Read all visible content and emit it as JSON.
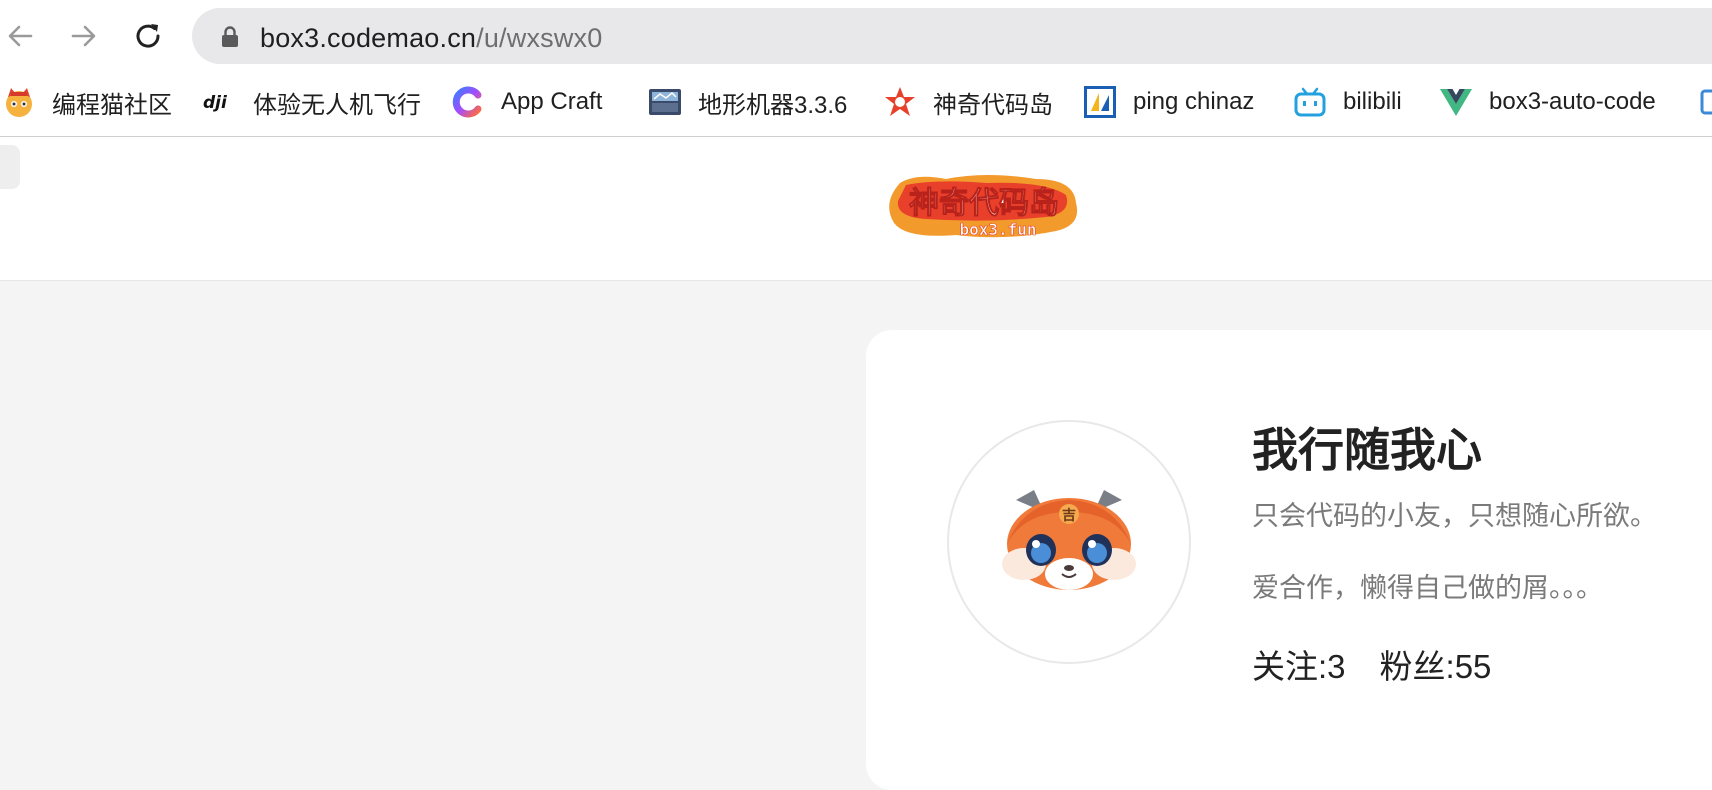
{
  "browser": {
    "url_host": "box3.codemao.cn",
    "url_path": "/u/wxswx0"
  },
  "bookmarks": [
    {
      "label": "编程猫社区",
      "icon": "codemao-community-icon"
    },
    {
      "label": "体验无人机飞行",
      "icon": "dji-icon"
    },
    {
      "label": "App Craft",
      "icon": "app-craft-icon"
    },
    {
      "label": "地形机器3.3.6",
      "icon": "terrain-machine-icon"
    },
    {
      "label": "神奇代码岛",
      "icon": "box3-star-icon"
    },
    {
      "label": "ping chinaz",
      "icon": "chinaz-icon"
    },
    {
      "label": "bilibili",
      "icon": "bilibili-icon"
    },
    {
      "label": "box3-auto-code",
      "icon": "vue-icon"
    }
  ],
  "site": {
    "logo_text": "神奇代码岛",
    "logo_subtext": "box3.fun"
  },
  "profile": {
    "name": "我行随我心",
    "bio_line1": "只会代码的小友，只想随心所欲。",
    "bio_line2": "爱合作，懒得自己做的屑。。。",
    "following_label": "关注:",
    "following_count": "3",
    "followers_label": "粉丝:",
    "followers_count": "55"
  },
  "colors": {
    "logo_red": "#e8402a",
    "logo_orange": "#f39a2c",
    "page_bg": "#f4f4f4"
  }
}
